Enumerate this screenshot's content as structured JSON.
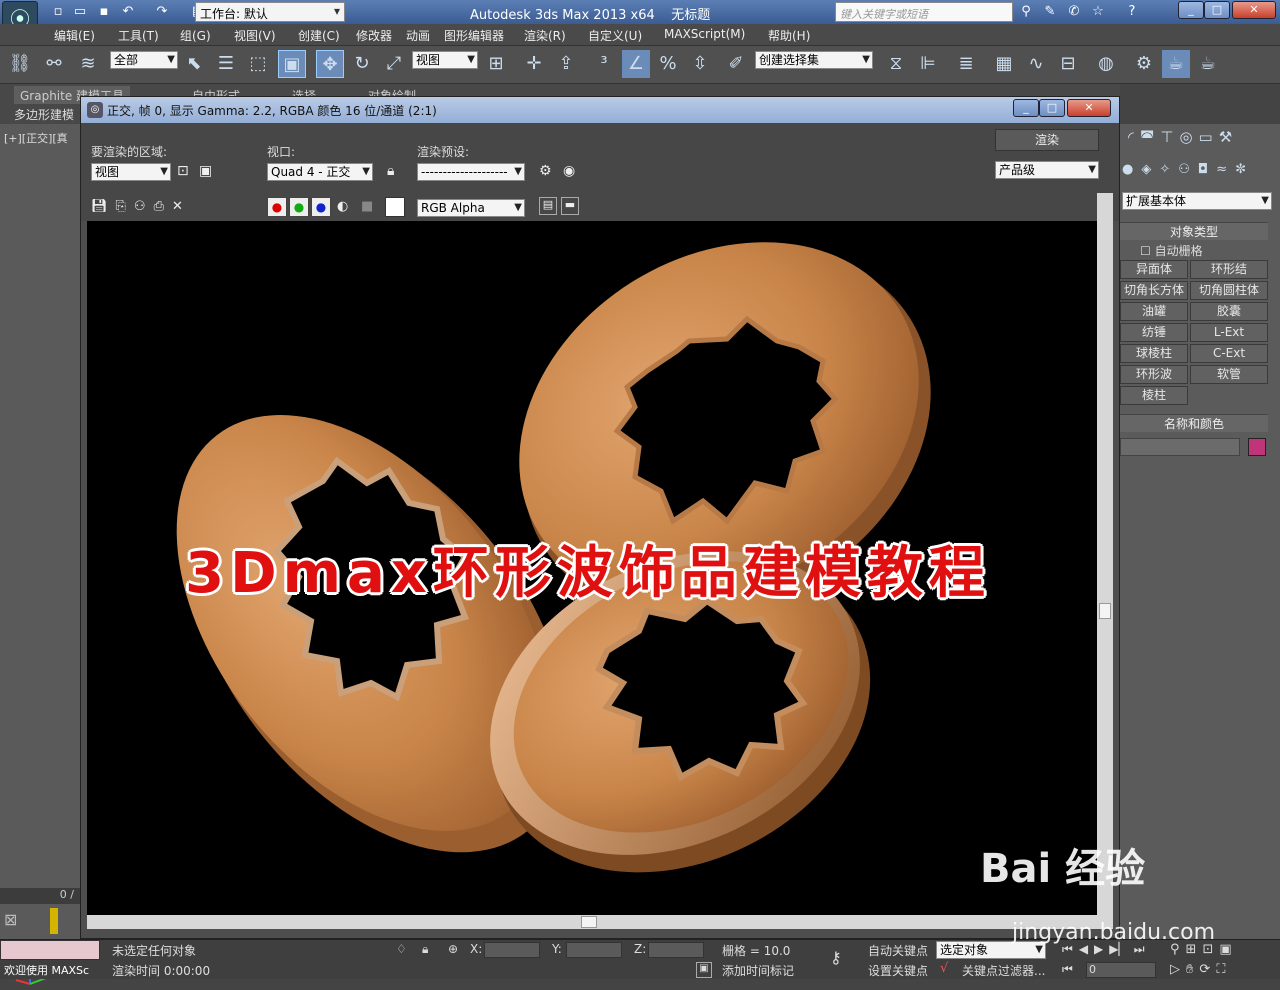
{
  "titlebar": {
    "app_title": "Autodesk 3ds Max  2013 x64",
    "doc_title": "无标题",
    "workspace": "工作台: 默认",
    "search_placeholder": "键入关键字或短语"
  },
  "menu": [
    "编辑(E)",
    "工具(T)",
    "组(G)",
    "视图(V)",
    "创建(C)",
    "修改器",
    "动画",
    "图形编辑器",
    "渲染(R)",
    "自定义(U)",
    "MAXScript(M)",
    "帮助(H)"
  ],
  "toolbar": {
    "selection_filter": "全部",
    "ref_coord": "视图",
    "named_selection": "创建选择集"
  },
  "ribbon": {
    "tabs": [
      "Graphite 建模工具",
      "自由形式",
      "选择",
      "对象绘制"
    ],
    "sub": "多边形建模"
  },
  "viewport": {
    "label": "[+][正交][真"
  },
  "render_window": {
    "title": "正交, 帧 0, 显示 Gamma: 2.2, RGBA 颜色 16 位/通道 (2:1)",
    "area_label": "要渲染的区域:",
    "area_value": "视图",
    "viewport_label": "视口:",
    "viewport_value": "Quad 4 - 正交",
    "preset_label": "渲染预设:",
    "preset_value": "--------------------",
    "render_button": "渲染",
    "quality_value": "产品级",
    "channel_value": "RGB Alpha"
  },
  "command_panel": {
    "dropdown": "扩展基本体",
    "rollout_object_type": "对象类型",
    "autogrid": "自动栅格",
    "buttons": [
      "异面体",
      "环形结",
      "切角长方体",
      "切角圆柱体",
      "油罐",
      "胶囊",
      "纺锤",
      "L-Ext",
      "球棱柱",
      "C-Ext",
      "环形波",
      "软管",
      "棱柱"
    ],
    "rollout_name_color": "名称和颜色",
    "swatch_color": "#c0357a"
  },
  "timeline": {
    "frame": "0 /"
  },
  "statusbar": {
    "welcome": "欢迎使用 MAXSc",
    "selection_status": "未选定任何对象",
    "render_time": "渲染时间 0:00:00",
    "x_label": "X:",
    "y_label": "Y:",
    "z_label": "Z:",
    "grid": "栅格 = 10.0",
    "add_time_tag": "添加时间标记",
    "auto_key": "自动关键点",
    "set_key": "设置关键点",
    "key_mode": "选定对象",
    "key_filters": "关键点过滤器...",
    "frame_field": "0"
  },
  "overlay_title": "3Dmax环形波饰品建模教程",
  "watermark": {
    "brand": "Bai 经验",
    "url": "jingyan.baidu.com"
  }
}
